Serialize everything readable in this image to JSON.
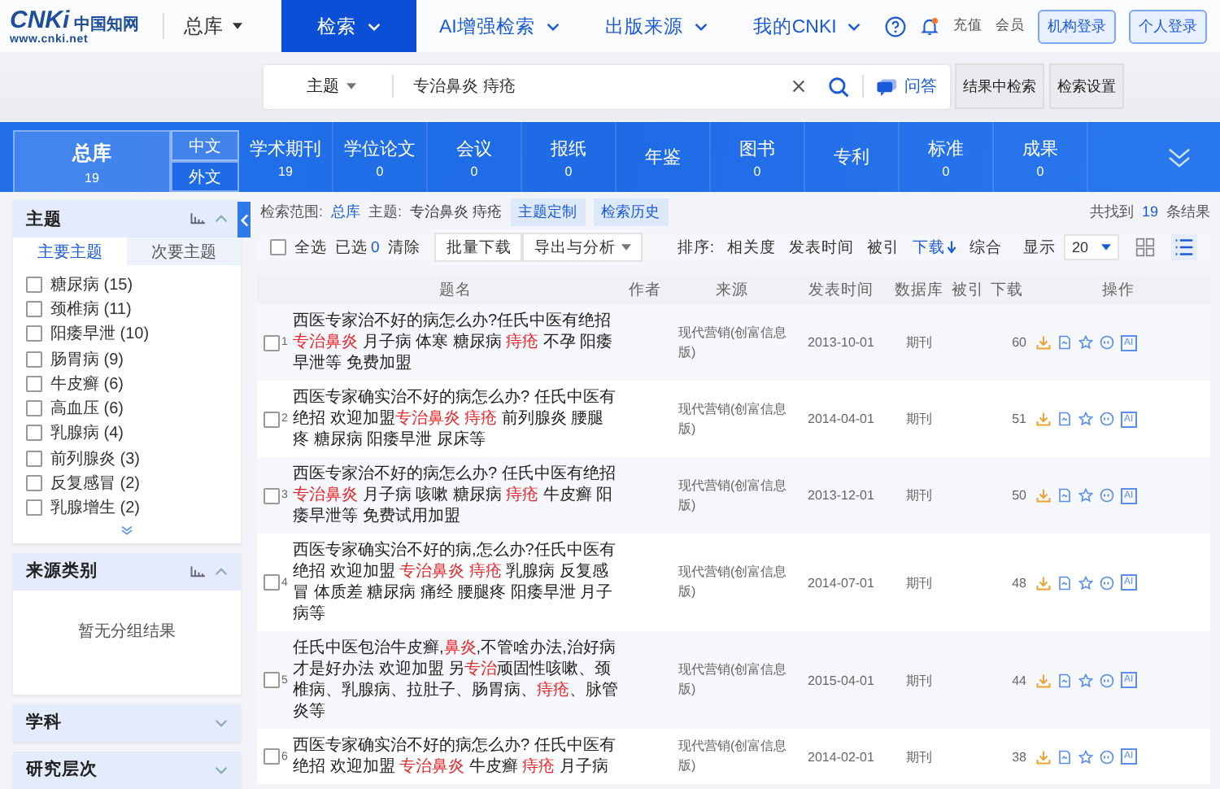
{
  "header": {
    "logo": {
      "mark": "CNKi",
      "name": "中国知网",
      "url": "www.cnki.net"
    },
    "library_menu": "总库",
    "nav": [
      {
        "label": "检索",
        "selected": true
      },
      {
        "label": "AI增强检索",
        "selected": false
      },
      {
        "label": "出版来源",
        "selected": false
      },
      {
        "label": "我的CNKI",
        "selected": false
      }
    ],
    "links": [
      "充值",
      "会员"
    ],
    "buttons": [
      "机构登录",
      "个人登录"
    ]
  },
  "search": {
    "field_type": "主题",
    "value": "专治鼻炎 痔疮",
    "qa_button": "问答",
    "buttons": [
      "结果中检索",
      "检索设置"
    ]
  },
  "categories": {
    "total": {
      "label": "总库",
      "count": "19"
    },
    "lang_tabs": [
      {
        "label": "中文",
        "selected": true
      },
      {
        "label": "外文",
        "selected": false
      }
    ],
    "items": [
      {
        "label": "学术期刊",
        "count": "19"
      },
      {
        "label": "学位论文",
        "count": "0"
      },
      {
        "label": "会议",
        "count": "0"
      },
      {
        "label": "报纸",
        "count": "0"
      },
      {
        "label": "年鉴"
      },
      {
        "label": "图书",
        "count": "0"
      },
      {
        "label": "专利"
      },
      {
        "label": "标准",
        "count": "0"
      },
      {
        "label": "成果",
        "count": "0"
      }
    ]
  },
  "sidebar": {
    "panels": [
      {
        "title": "主题",
        "expanded": true,
        "tabs": [
          {
            "label": "主要主题",
            "selected": true
          },
          {
            "label": "次要主题",
            "selected": false
          }
        ],
        "items": [
          {
            "label": "糖尿病 (15)",
            "checked": false
          },
          {
            "label": "颈椎病 (11)",
            "checked": false
          },
          {
            "label": "阳痿早泄 (10)",
            "checked": false
          },
          {
            "label": "肠胃病 (9)",
            "checked": false
          },
          {
            "label": "牛皮癣 (6)",
            "checked": false
          },
          {
            "label": "高血压 (6)",
            "checked": false
          },
          {
            "label": "乳腺病 (4)",
            "checked": false
          },
          {
            "label": "前列腺炎 (3)",
            "checked": false
          },
          {
            "label": "反复感冒 (2)",
            "checked": false
          },
          {
            "label": "乳腺增生 (2)",
            "checked": false
          }
        ]
      },
      {
        "title": "来源类别",
        "expanded": true,
        "empty_text": "暂无分组结果"
      },
      {
        "title": "学科",
        "expanded": false
      },
      {
        "title": "研究层次",
        "expanded": false
      }
    ]
  },
  "results": {
    "scope_label": "检索范围:",
    "scope": "总库",
    "query_label": "主题:",
    "query": "专治鼻炎 痔疮",
    "tag_buttons": [
      "主题定制",
      "检索历史"
    ],
    "found_prefix": "共找到",
    "found_count": "19",
    "found_suffix": "条结果",
    "toolbar": {
      "select_all": {
        "label": "全选",
        "checked": false
      },
      "selected_label": "已选",
      "selected_count": "0",
      "clear": "清除",
      "buttons": [
        "批量下载",
        "导出与分析"
      ],
      "sort_label": "排序:",
      "sort_options": [
        {
          "label": "相关度",
          "selected": false
        },
        {
          "label": "发表时间",
          "selected": false
        },
        {
          "label": "被引",
          "selected": false
        },
        {
          "label": "下载",
          "selected": true
        },
        {
          "label": "综合",
          "selected": false
        }
      ],
      "page_size_label": "显示",
      "page_size": "20",
      "views": [
        {
          "kind": "grid",
          "selected": false
        },
        {
          "kind": "list",
          "selected": true
        }
      ]
    },
    "table": {
      "columns": [
        "题名",
        "作者",
        "来源",
        "发表时间",
        "数据库",
        "被引",
        "下载",
        "操作"
      ],
      "rows": [
        {
          "number": "1",
          "checked": false,
          "title": [
            {
              "text": "西医专家治不好的病怎么办?任氏中医有绝招 ",
              "highlight": false
            },
            {
              "text": "专治鼻炎",
              "highlight": true
            },
            {
              "text": " 月子病 体寒 糖尿病 ",
              "highlight": false
            },
            {
              "text": "痔疮",
              "highlight": true
            },
            {
              "text": " 不孕 阳痿早泄等 免费加盟",
              "highlight": false
            }
          ],
          "source": "现代营销(创富信息版)",
          "date": "2013-10-01",
          "database": "期刊",
          "downloads": "60",
          "ai_label": "AI"
        },
        {
          "number": "2",
          "checked": false,
          "title": [
            {
              "text": "西医专家确实治不好的病怎么办? 任氏中医有绝招 欢迎加盟",
              "highlight": false
            },
            {
              "text": "专治鼻炎 痔疮",
              "highlight": true
            },
            {
              "text": " 前列腺炎 腰腿疼 糖尿病 阳痿早泄 尿床等",
              "highlight": false
            }
          ],
          "source": "现代营销(创富信息版)",
          "date": "2014-04-01",
          "database": "期刊",
          "downloads": "51",
          "ai_label": "AI"
        },
        {
          "number": "3",
          "checked": false,
          "title": [
            {
              "text": "西医专家治不好的病怎么办? 任氏中医有绝招 ",
              "highlight": false
            },
            {
              "text": "专治鼻炎",
              "highlight": true
            },
            {
              "text": " 月子病 咳嗽 糖尿病 ",
              "highlight": false
            },
            {
              "text": "痔疮",
              "highlight": true
            },
            {
              "text": " 牛皮癣 阳痿早泄等 免费试用加盟",
              "highlight": false
            }
          ],
          "source": "现代营销(创富信息版)",
          "date": "2013-12-01",
          "database": "期刊",
          "downloads": "50",
          "ai_label": "AI"
        },
        {
          "number": "4",
          "checked": false,
          "title": [
            {
              "text": "西医专家确实治不好的病,怎么办?任氏中医有绝招 欢迎加盟 ",
              "highlight": false
            },
            {
              "text": "专治鼻炎 痔疮",
              "highlight": true
            },
            {
              "text": " 乳腺病 反复感冒 体质差 糖尿病 痛经 腰腿疼 阳痿早泄 月子病等",
              "highlight": false
            }
          ],
          "source": "现代营销(创富信息版)",
          "date": "2014-07-01",
          "database": "期刊",
          "downloads": "48",
          "ai_label": "AI"
        },
        {
          "number": "5",
          "checked": false,
          "title": [
            {
              "text": "任氏中医包治牛皮癣,",
              "highlight": false
            },
            {
              "text": "鼻炎",
              "highlight": true
            },
            {
              "text": ",不管啥办法,治好病才是好办法 欢迎加盟 另",
              "highlight": false
            },
            {
              "text": "专治",
              "highlight": true
            },
            {
              "text": "顽固性咳嗽、颈椎病、乳腺病、拉肚子、肠胃病、",
              "highlight": false
            },
            {
              "text": "痔疮",
              "highlight": true
            },
            {
              "text": "、脉管炎等",
              "highlight": false
            }
          ],
          "source": "现代营销(创富信息版)",
          "date": "2015-04-01",
          "database": "期刊",
          "downloads": "44",
          "ai_label": "AI"
        },
        {
          "number": "6",
          "checked": false,
          "title": [
            {
              "text": "西医专家确实治不好的病怎么办? 任氏中医有绝招 欢迎加盟 ",
              "highlight": false
            },
            {
              "text": "专治鼻炎",
              "highlight": true
            },
            {
              "text": " 牛皮癣 ",
              "highlight": false
            },
            {
              "text": "痔疮",
              "highlight": true
            },
            {
              "text": " 月子病",
              "highlight": false
            }
          ],
          "source": "现代营销(创富信息版)",
          "date": "2014-02-01",
          "database": "期刊",
          "downloads": "38",
          "ai_label": "AI"
        }
      ]
    }
  }
}
